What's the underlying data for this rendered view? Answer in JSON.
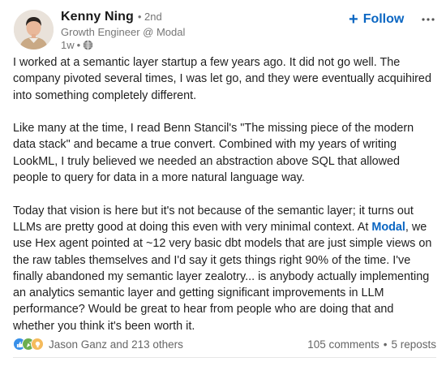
{
  "author": {
    "name": "Kenny Ning",
    "degree": "• 2nd",
    "headline": "Growth Engineer @ Modal",
    "time": "1w",
    "dot": "•",
    "visibility_icon": "globe-icon"
  },
  "actions": {
    "follow_label": "Follow",
    "follow_icon": "+",
    "more_icon": "more-horizontal-icon"
  },
  "post": {
    "p1": "I worked at a semantic layer startup a few years ago. It did not go well. The company pivoted several times, I was let go, and they were eventually acquihired into something completely different.",
    "p2": "Like many at the time, I read Benn Stancil's \"The missing piece of the modern data stack\" and became a true convert. Combined with my years of writing LookML, I truly believed we needed an abstraction above SQL that allowed people to query for data in a more natural language way.",
    "p3_a": "Today that vision is here but it's not because of the semantic layer; it turns out LLMs are pretty good at doing this even with very minimal context. At ",
    "p3_mention": "Modal",
    "p3_b": ", we use Hex agent pointed at ~12 very basic dbt models that are just simple views on the raw tables themselves and I'd say it gets things right 90% of the time. I've finally abandoned my semantic layer zealotry... is anybody actually implementing an analytics semantic layer and getting significant improvements in LLM performance? Would be great to hear from people who are doing that and whether you think it's been worth it."
  },
  "social": {
    "reaction_icons": [
      "like-icon",
      "celebrate-icon",
      "insightful-icon"
    ],
    "reactors": "Jason Ganz and 213 others",
    "comments": "105 comments",
    "separator": "•",
    "reposts": "5 reposts"
  },
  "colors": {
    "link_blue": "#0a66c2",
    "muted_text": "#666666",
    "like": "#378fe9",
    "celebrate": "#44712e",
    "insightful": "#f5bb5c"
  }
}
